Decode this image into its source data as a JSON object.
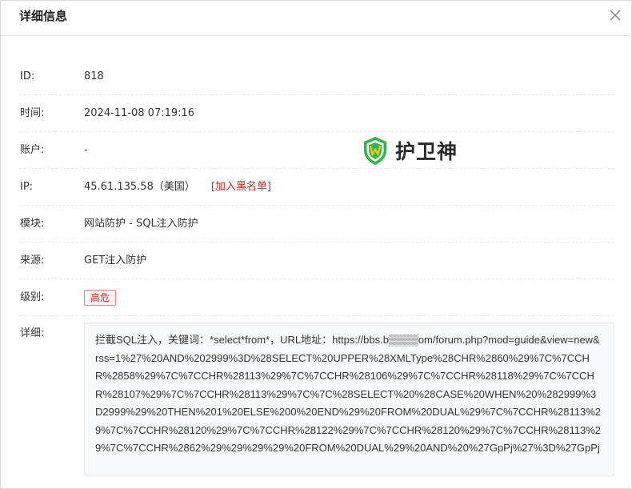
{
  "dialog": {
    "title": "详细信息"
  },
  "fields": {
    "id": {
      "label": "ID:",
      "value": "818"
    },
    "time": {
      "label": "时间:",
      "value": "2024-11-08 07:19:16"
    },
    "account": {
      "label": "账户:",
      "value": "-"
    },
    "ip": {
      "label": "IP:",
      "value": "45.61.135.58（美国）",
      "blacklist_label": "[加入黑名单]"
    },
    "module": {
      "label": "模块:",
      "value": "网站防护 - SQL注入防护"
    },
    "source": {
      "label": "来源:",
      "value": "GET注入防护"
    },
    "level": {
      "label": "级别:",
      "value": "高危"
    },
    "detail": {
      "label": "详细:",
      "value": "拦截SQL注入，关键词：*select*from*，URL地址：https://bbs.b▒▒▒▒om/forum.php?mod=guide&view=new&rss=1%27%20AND%202999%3D%28SELECT%20UPPER%28XMLType%28CHR%2860%29%7C%7CCHR%2858%29%7C%7CCHR%28113%29%7C%7CCHR%28106%29%7C%7CCHR%28118%29%7C%7CCHR%28107%29%7C%7CCHR%28113%29%7C%7C%28SELECT%20%28CASE%20WHEN%20%282999%3D2999%29%20THEN%201%20ELSE%200%20END%29%20FROM%20DUAL%29%7C%7CCHR%28113%29%7C%7CCHR%28120%29%7C%7CCHR%28122%29%7C%7CCHR%28120%29%7C%7CCHR%28113%29%7C%7CCHR%2862%29%29%29%29%20FROM%20DUAL%29%20AND%20%27GpPj%27%3D%27GpPj"
    }
  },
  "watermark": {
    "text": "护卫神",
    "icon": "shield-w-icon",
    "color_primary": "#2fb84a",
    "color_accent": "#f5c518"
  },
  "colors": {
    "danger": "#e02020",
    "badge_bg": "#fff3f3",
    "detail_bg": "#f7f8fa"
  }
}
